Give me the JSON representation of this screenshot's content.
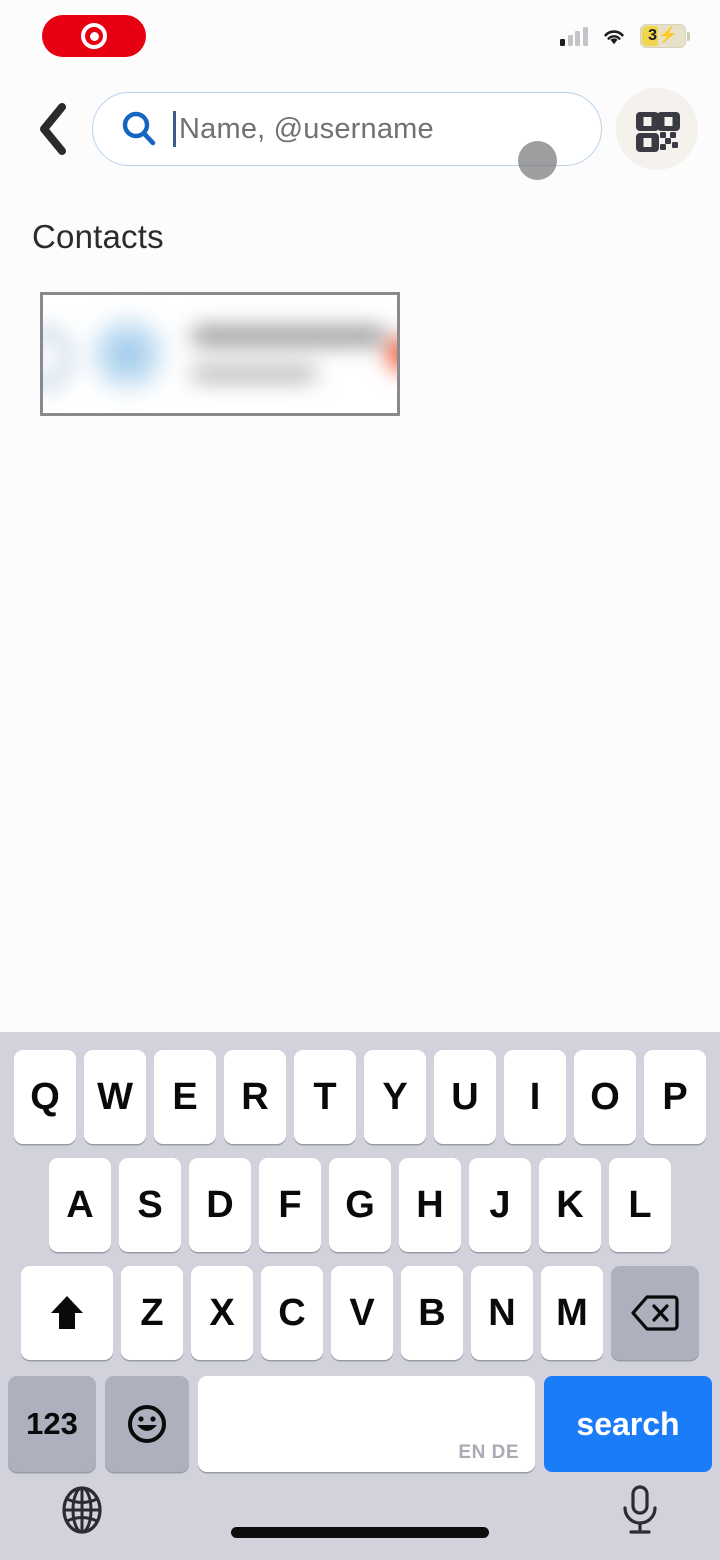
{
  "status_bar": {
    "recording_indicator": "screen-recording-pill",
    "signal_label": "cellular-signal",
    "signal_bars_active": 1,
    "signal_bars_total": 4,
    "wifi_label": "wifi",
    "battery_level": "3",
    "battery_charging_glyph": "⚡",
    "battery_is_charging": true
  },
  "header": {
    "back_label": "‹",
    "search": {
      "placeholder": "Name, @username",
      "value": "",
      "icon": "search-icon",
      "caret_visible": true
    },
    "qr_button_label": "qr-code-scanner"
  },
  "main": {
    "section_title": "Contacts",
    "contacts": [
      {
        "name_redacted": true,
        "username_redacted": true,
        "badge_color": "#f4522c",
        "avatar_color": "#8ec3ea"
      }
    ]
  },
  "keyboard": {
    "row1": [
      "Q",
      "W",
      "E",
      "R",
      "T",
      "Y",
      "U",
      "I",
      "O",
      "P"
    ],
    "row2": [
      "A",
      "S",
      "D",
      "F",
      "G",
      "H",
      "J",
      "K",
      "L"
    ],
    "row3_letters": [
      "Z",
      "X",
      "C",
      "V",
      "B",
      "N",
      "M"
    ],
    "shift_label": "⬆",
    "backspace_label": "⌫",
    "numeric_label": "123",
    "emoji_label": "☺",
    "space_label": "",
    "space_languages": "EN DE",
    "return_label": "search",
    "globe_label": "globe-language-switcher",
    "mic_label": "microphone-dictation"
  },
  "colors": {
    "accent_blue": "#1a7cf7",
    "search_border": "#b9d3ea",
    "recording_red": "#e60012",
    "badge_orange": "#f4522c",
    "keyboard_bg": "#d1d2db",
    "page_bg": "#fdfcfc"
  }
}
